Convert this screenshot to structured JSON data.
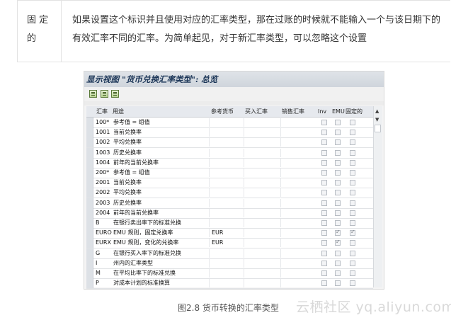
{
  "doc": {
    "term": "固 定的",
    "description": "如果设置这个标识并且使用对应的汇率类型，那在过账的时候就不能输入一个与该日期下的有效汇率不同的汇率。为简单起见，对于新汇率类型，可以忽略这个设置"
  },
  "sap": {
    "title": "显示视图 \"货币兑换汇率类型\": 总览",
    "toolbar_icons": [
      "display-icon",
      "copy-icon",
      "print-icon"
    ],
    "columns": [
      "汇率",
      "用途",
      "参考货币",
      "买入汇率",
      "销售汇率",
      "Inv",
      "EMU",
      "固定的"
    ],
    "rows": [
      {
        "rate": "100*",
        "usage": "参考值 = 组值",
        "ref": "",
        "inv": false,
        "emu": false,
        "fixed": false
      },
      {
        "rate": "1001",
        "usage": "当前兑换率",
        "ref": "",
        "inv": false,
        "emu": false,
        "fixed": false
      },
      {
        "rate": "1002",
        "usage": "平均兑换率",
        "ref": "",
        "inv": false,
        "emu": false,
        "fixed": false
      },
      {
        "rate": "1003",
        "usage": "历史兑换率",
        "ref": "",
        "inv": false,
        "emu": false,
        "fixed": false
      },
      {
        "rate": "1004",
        "usage": "前年的当前兑换率",
        "ref": "",
        "inv": false,
        "emu": false,
        "fixed": false
      },
      {
        "rate": "200*",
        "usage": "参考值 = 组值",
        "ref": "",
        "inv": false,
        "emu": false,
        "fixed": false
      },
      {
        "rate": "2001",
        "usage": "当前兑换率",
        "ref": "",
        "inv": false,
        "emu": false,
        "fixed": false
      },
      {
        "rate": "2002",
        "usage": "平均兑换率",
        "ref": "",
        "inv": false,
        "emu": false,
        "fixed": false
      },
      {
        "rate": "2003",
        "usage": "历史兑换率",
        "ref": "",
        "inv": false,
        "emu": false,
        "fixed": false
      },
      {
        "rate": "2004",
        "usage": "前年的当前兑换率",
        "ref": "",
        "inv": false,
        "emu": false,
        "fixed": false
      },
      {
        "rate": "B",
        "usage": "在银行卖出率下的标准兑换",
        "ref": "",
        "inv": false,
        "emu": false,
        "fixed": false
      },
      {
        "rate": "EURO",
        "usage": "EMU 规则，固定兑换率",
        "ref": "EUR",
        "inv": false,
        "emu": true,
        "fixed": true
      },
      {
        "rate": "EURX",
        "usage": "EMU 规则，变化的兑换率",
        "ref": "EUR",
        "inv": false,
        "emu": true,
        "fixed": false
      },
      {
        "rate": "G",
        "usage": "在银行买入率下的标准兑换",
        "ref": "",
        "inv": false,
        "emu": false,
        "fixed": false
      },
      {
        "rate": "I",
        "usage": "州内的汇率类型",
        "ref": "",
        "inv": false,
        "emu": false,
        "fixed": false
      },
      {
        "rate": "M",
        "usage": "在平均比率下的标准兑换",
        "ref": "",
        "inv": false,
        "emu": false,
        "fixed": false
      },
      {
        "rate": "P",
        "usage": "对成本计划的标准换算",
        "ref": "",
        "inv": false,
        "emu": false,
        "fixed": false
      }
    ]
  },
  "caption": "图2.8 货币转换的汇率类型",
  "watermark": "云栖社区 yq.aliyun.com"
}
